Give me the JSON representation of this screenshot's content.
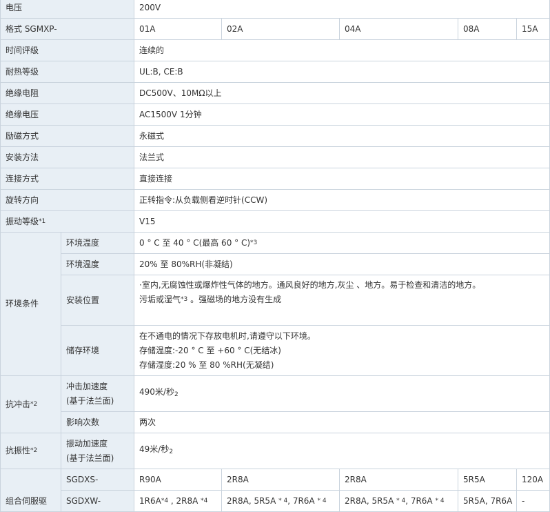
{
  "colors": {
    "header_bg": "#e8eff5",
    "border": "#c9d3dd",
    "text": "#333333"
  },
  "rows": {
    "voltage": {
      "label": "电压",
      "value": "200V"
    },
    "model": {
      "label": "格式 SGMXP-",
      "cols": [
        "01A",
        "02A",
        "04A",
        "08A",
        "15A"
      ]
    },
    "time_rating": {
      "label": "时间评级",
      "value": "连续的"
    },
    "heat_class": {
      "label": "耐热等级",
      "value": "UL:B, CE:B"
    },
    "insulation_resistance": {
      "label": "绝缘电阻",
      "value": "DC500V、10MΩ以上"
    },
    "insulation_voltage": {
      "label": "绝缘电压",
      "value": "AC1500V 1分钟"
    },
    "excitation": {
      "label": "励磁方式",
      "value": "永磁式"
    },
    "mounting": {
      "label": "安装方法",
      "value": "法兰式"
    },
    "connection": {
      "label": "连接方式",
      "value": "直接连接"
    },
    "rotation": {
      "label": "旋转方向",
      "value": "正转指令:从负载侧看逆时针(CCW)"
    },
    "vibration_class": {
      "label": "振动等级",
      "note": "*1",
      "value": "V15"
    },
    "environment": {
      "label": "环境条件",
      "ambient_temp": {
        "label": "环境温度",
        "value": "0 ° C 至 40 ° C(最高 60 ° C)",
        "note": "*3"
      },
      "ambient_humidity": {
        "label": "环境温度",
        "value": "20% 至 80%RH(非凝结)"
      },
      "install_location": {
        "label": "安装位置",
        "line1": "·室内,无腐蚀性或爆炸性气体的地方。通风良好的地方,灰尘 、地方。易于检查和清洁的地方。",
        "line2a": "污垢或湿气",
        "note": "*3",
        "line2b": " 。强磁场的地方没有生成"
      },
      "storage": {
        "label": "储存环境",
        "line1": "在不通电的情况下存放电机时,请遵守以下环境。",
        "line2": "存储温度:-20 ° C 至 +60 ° C(无结冰)",
        "line3": "存储湿度:20 % 至 80 %RH(无凝结)"
      }
    },
    "shock": {
      "label": "抗冲击",
      "note": "*2",
      "accel": {
        "label1": "冲击加速度",
        "label2": "(基于法兰面)",
        "value": "490米/秒",
        "exp": "2"
      },
      "times": {
        "label": "影响次数",
        "value": "两次"
      }
    },
    "vibration_res": {
      "label": "抗振性",
      "note": "*2",
      "accel": {
        "label1": "振动加速度",
        "label2": "(基于法兰面)",
        "value": "49米/秒",
        "exp": "2"
      }
    },
    "servo": {
      "label": "组合伺服驱",
      "sgdxs": {
        "label": "SGDXS-",
        "cols": [
          "R90A",
          "2R8A",
          "2R8A",
          "5R5A",
          "120A"
        ]
      },
      "sgdxw": {
        "label": "SGDXW-",
        "c1a": "1R6A",
        "c1n1": "*4",
        "c1b": " , 2R8A ",
        "c1n2": "*4",
        "c2a": "2R8A, 5R5A ",
        "c2n1": "* 4",
        "c2b": ", 7R6A ",
        "c2n2": "* 4",
        "c3a": "2R8A, 5R5A ",
        "c3n1": "* 4",
        "c3b": ", 7R6A ",
        "c3n2": "* 4",
        "c4": "5R5A, 7R6A",
        "c5": "-"
      }
    }
  }
}
